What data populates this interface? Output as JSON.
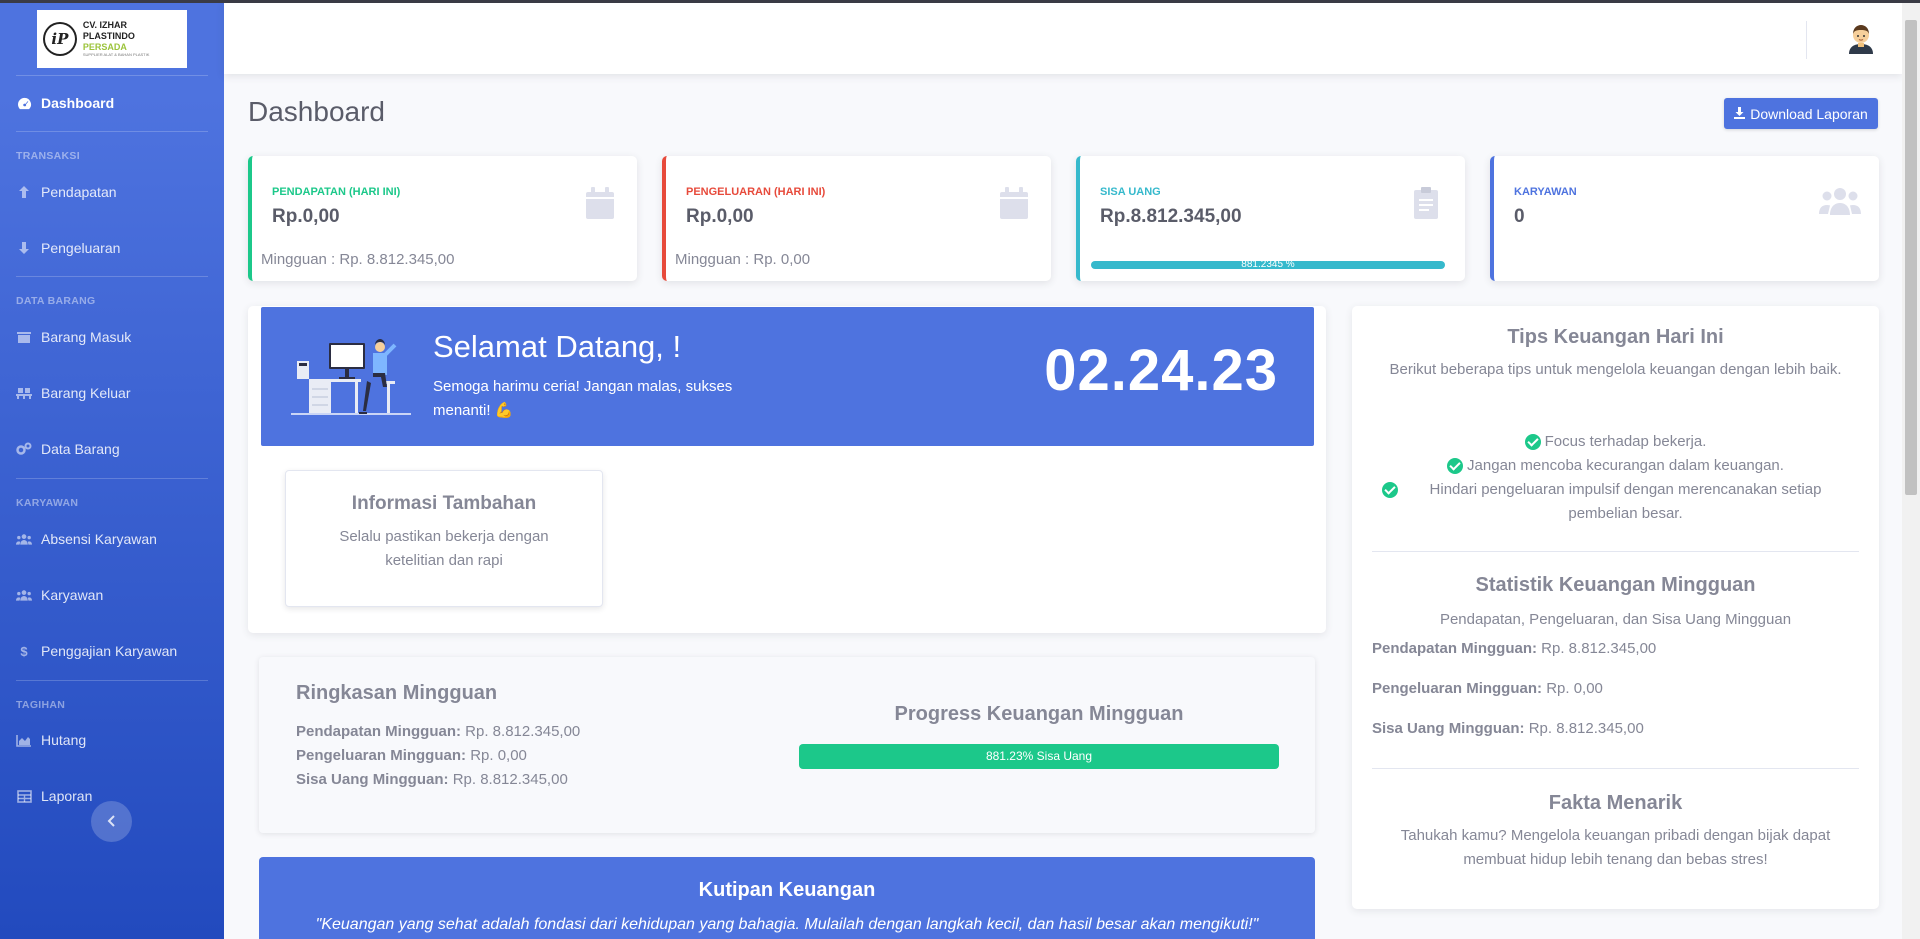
{
  "brand": {
    "line1": "CV. IZHAR PLASTINDO",
    "line2": "PERSADA",
    "line3": "SUPPLIER ALAT & BAHAN PLASTIK"
  },
  "sidebar": {
    "dashboard": "Dashboard",
    "headings": [
      "TRANSAKSI",
      "DATA BARANG",
      "KARYAWAN",
      "TAGIHAN"
    ],
    "items": [
      {
        "label": "Pendapatan",
        "icon": "arrow-up-icon"
      },
      {
        "label": "Pengeluaran",
        "icon": "arrow-down-icon"
      },
      {
        "label": "Barang Masuk",
        "icon": "box-icon"
      },
      {
        "label": "Barang Keluar",
        "icon": "pallet-icon"
      },
      {
        "label": "Data Barang",
        "icon": "gears-icon"
      },
      {
        "label": "Absensi Karyawan",
        "icon": "users-icon"
      },
      {
        "label": "Karyawan",
        "icon": "users-icon"
      },
      {
        "label": "Penggajian Karyawan",
        "icon": "dollar-icon"
      },
      {
        "label": "Hutang",
        "icon": "chart-area-icon"
      },
      {
        "label": "Laporan",
        "icon": "table-icon"
      }
    ]
  },
  "header": {
    "title": "Dashboard",
    "download_label": "Download Laporan"
  },
  "cards": [
    {
      "label": "PENDAPATAN (HARI INI)",
      "value": "Rp.0,00",
      "sub": "Mingguan : Rp. 8.812.345,00",
      "color": "#1cc88a",
      "icon": "calendar-icon"
    },
    {
      "label": "PENGELUARAN (HARI INI)",
      "value": "Rp.0,00",
      "sub": "Mingguan : Rp. 0,00",
      "color": "#e74a3b",
      "icon": "calendar-icon"
    },
    {
      "label": "SISA UANG",
      "value": "Rp.8.812.345,00",
      "progress_text": "881.2345 %",
      "progress": 100,
      "color": "#36b9cc",
      "icon": "clipboard-icon"
    },
    {
      "label": "KARYAWAN",
      "value": "0",
      "color": "#4e73df",
      "icon": "users-icon"
    }
  ],
  "welcome": {
    "title": "Selamat Datang, !",
    "subtitle": "Semoga harimu ceria! Jangan malas, sukses menanti! 💪",
    "time": "02.24.23"
  },
  "info": {
    "title": "Informasi Tambahan",
    "text": "Selalu pastikan bekerja dengan ketelitian dan rapi"
  },
  "summary": {
    "title": "Ringkasan Mingguan",
    "rows": [
      {
        "label": "Pendapatan Mingguan:",
        "value": "Rp. 8.812.345,00"
      },
      {
        "label": "Pengeluaran Mingguan:",
        "value": "Rp. 0,00"
      },
      {
        "label": "Sisa Uang Mingguan:",
        "value": "Rp. 8.812.345,00"
      }
    ],
    "progress_title": "Progress Keuangan Mingguan",
    "progress_text": "881.23% Sisa Uang",
    "progress": 100
  },
  "quote": {
    "title": "Kutipan Keuangan",
    "text": "\"Keuangan yang sehat adalah fondasi dari kehidupan yang bahagia. Mulailah dengan langkah kecil, dan hasil besar akan mengikuti!\""
  },
  "tips": {
    "title": "Tips Keuangan Hari Ini",
    "intro": "Berikut beberapa tips untuk mengelola keuangan dengan lebih baik.",
    "items": [
      "Focus terhadap bekerja.",
      "Jangan mencoba kecurangan dalam keuangan.",
      "Hindari pengeluaran impulsif dengan merencanakan setiap pembelian besar."
    ]
  },
  "weekly_stats": {
    "title": "Statistik Keuangan Mingguan",
    "subtitle": "Pendapatan, Pengeluaran, dan Sisa Uang Mingguan",
    "rows": [
      {
        "label": "Pendapatan Mingguan:",
        "value": "Rp. 8.812.345,00"
      },
      {
        "label": "Pengeluaran Mingguan:",
        "value": "Rp. 0,00"
      },
      {
        "label": "Sisa Uang Mingguan:",
        "value": "Rp. 8.812.345,00"
      }
    ]
  },
  "fact": {
    "title": "Fakta Menarik",
    "text": "Tahukah kamu? Mengelola keuangan pribadi dengan bijak dapat membuat hidup lebih tenang dan bebas stres!"
  }
}
